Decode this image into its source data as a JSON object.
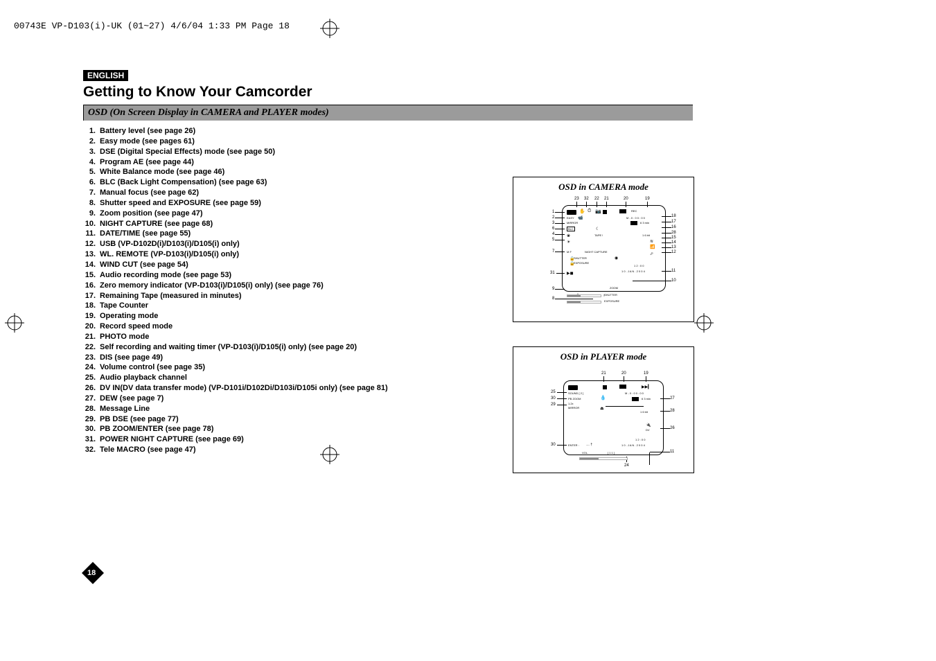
{
  "topbar": "00743E VP-D103(i)-UK (01~27)  4/6/04 1:33 PM  Page 18",
  "eng": "ENGLISH",
  "title": "Getting to Know Your Camcorder",
  "bar": "OSD (On Screen Display in CAMERA and PLAYER modes)",
  "items": [
    "Battery level (see page 26)",
    "Easy mode (see pages 61)",
    "DSE (Digital Special Effects) mode (see page 50)",
    "Program AE (see page 44)",
    "White Balance mode (see page 46)",
    "BLC (Back Light Compensation) (see page 63)",
    "Manual focus (see page 62)",
    "Shutter speed and EXPOSURE (see page 59)",
    "Zoom position (see page 47)",
    "NIGHT CAPTURE (see page 68)",
    "DATE/TIME (see page 55)",
    "USB (VP-D102D(i)/D103(i)/D105(i) only)",
    "WL. REMOTE (VP-D103(i)/D105(i) only)",
    "WIND CUT (see page 54)",
    "Audio recording mode (see page 53)",
    "Zero memory indicator (VP-D103(i)/D105(i) only) (see page 76)",
    "Remaining Tape (measured in minutes)",
    "Tape Counter",
    "Operating mode",
    "Record speed mode",
    "PHOTO mode",
    "Self recording and waiting timer (VP-D103(i)/D105(i) only) (see page 20)",
    "DIS (see page 49)",
    "Volume control (see page 35)",
    "Audio playback channel",
    "DV IN(DV data transfer mode) (VP-D101i/D102Di/D103i/D105i only) (see page 81)",
    "DEW (see page 7)",
    "Message Line",
    "PB DSE (see page 77)",
    "PB ZOOM/ENTER (see page 78)",
    "POWER NIGHT CAPTURE (see page 69)",
    "Tele MACRO (see page 47)"
  ],
  "page_num": "18",
  "dia1": {
    "title": "OSD in CAMERA mode",
    "topnums": [
      "23",
      "32",
      "22",
      "21",
      "20",
      "19"
    ],
    "leftnums": [
      "1",
      "2",
      "3",
      "6",
      "4",
      "5",
      "7",
      "31",
      "9",
      "8"
    ],
    "rightnums": [
      "18",
      "17",
      "16",
      "28",
      "15",
      "14",
      "13",
      "12",
      "11",
      "10"
    ],
    "micro": {
      "easy": "EASY",
      "mirror": "MIRROR",
      "blc": "BLC",
      "mf": "M F",
      "tape": "TAPE !",
      "shutter": "SHUTTER",
      "exposure": "EXPOSURE",
      "night": "NIGHT CAPTURE",
      "zoom": "ZOOM",
      "shutter2": "SHUTTER",
      "exposure2": "EXPOSURE",
      "rec": "REC",
      "counter": "M - 0 : 0 0 : 0 0",
      "remain": "6 3 min",
      "sixteen": "1 6 bit",
      "time": "1 2 : 0 0",
      "date": "1 0 . J A N . 2 0 0 4"
    }
  },
  "dia2": {
    "title": "OSD in PLAYER mode",
    "topnums": [
      "21",
      "20",
      "19"
    ],
    "leftnums": [
      "25",
      "30",
      "29",
      "30"
    ],
    "rightnums": [
      "27",
      "28",
      "26",
      "11"
    ],
    "bottomnum": "24",
    "micro": {
      "sound": "SOUND [ 2 ]",
      "pbzoom": "PB ZOOM",
      "mult": "1.2x",
      "mirror": "MIRROR",
      "enter": "ENTER :",
      "vol": "VOL.",
      "volval": "[ 1 1 ]",
      "counter": "M - 0 : 0 0 : 0 0",
      "remain": "6 3 min",
      "sixteen": "1 6 bit",
      "dv": "DV",
      "time": "1 2 : 0 0",
      "date": "1 0 . J A N . 2 0 0 4",
      "marks": "…   †"
    }
  }
}
